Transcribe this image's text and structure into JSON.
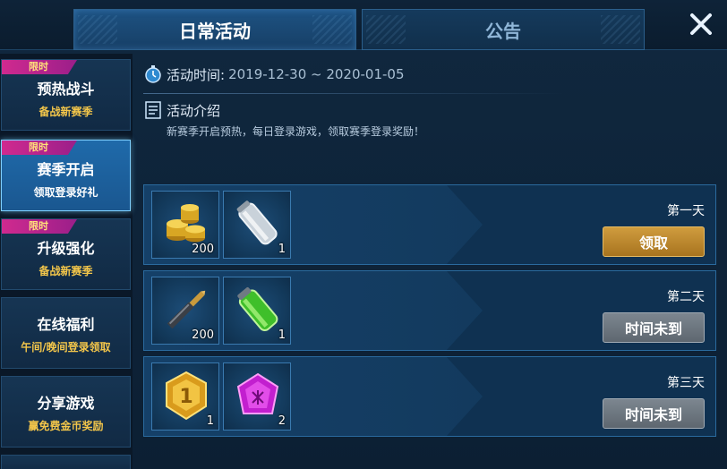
{
  "header": {
    "tabs": [
      {
        "label": "日常活动",
        "active": true
      },
      {
        "label": "公告",
        "active": false
      }
    ],
    "close_icon": "close-icon"
  },
  "sidebar": {
    "items": [
      {
        "badge": "限时",
        "title": "预热战斗",
        "subtitle": "备战新赛季",
        "active": false
      },
      {
        "badge": "限时",
        "title": "赛季开启",
        "subtitle": "领取登录好礼",
        "active": true
      },
      {
        "badge": "限时",
        "title": "升级强化",
        "subtitle": "备战新赛季",
        "active": false
      },
      {
        "badge": "",
        "title": "在线福利",
        "subtitle": "午间/晚间登录领取",
        "active": false
      },
      {
        "badge": "",
        "title": "分享游戏",
        "subtitle": "赢免费金币奖励",
        "active": false
      }
    ]
  },
  "activity": {
    "time_label": "活动时间:",
    "time_value": "2019-12-30 ~ 2020-01-05",
    "intro_label": "活动介绍",
    "intro_desc": "新赛季开启预热，每日登录游戏，领取赛季登录奖励！"
  },
  "rewards": [
    {
      "day": "第一天",
      "button": "领取",
      "button_state": "claimable",
      "items": [
        {
          "icon": "gold-coins-icon",
          "qty": "200"
        },
        {
          "icon": "silver-canister-icon",
          "qty": "1"
        }
      ]
    },
    {
      "day": "第二天",
      "button": "时间未到",
      "button_state": "disabled",
      "items": [
        {
          "icon": "bullet-icon",
          "qty": "200"
        },
        {
          "icon": "green-battery-icon",
          "qty": "1"
        }
      ]
    },
    {
      "day": "第三天",
      "button": "时间未到",
      "button_state": "disabled",
      "items": [
        {
          "icon": "gold-medal-icon",
          "qty": "1"
        },
        {
          "icon": "purple-gem-icon",
          "qty": "2"
        }
      ]
    }
  ],
  "colors": {
    "claim_button": "#b98430",
    "disabled_button": "#6d767f",
    "badge": "#c8278e",
    "subtitle_gold": "#f3c64a"
  }
}
